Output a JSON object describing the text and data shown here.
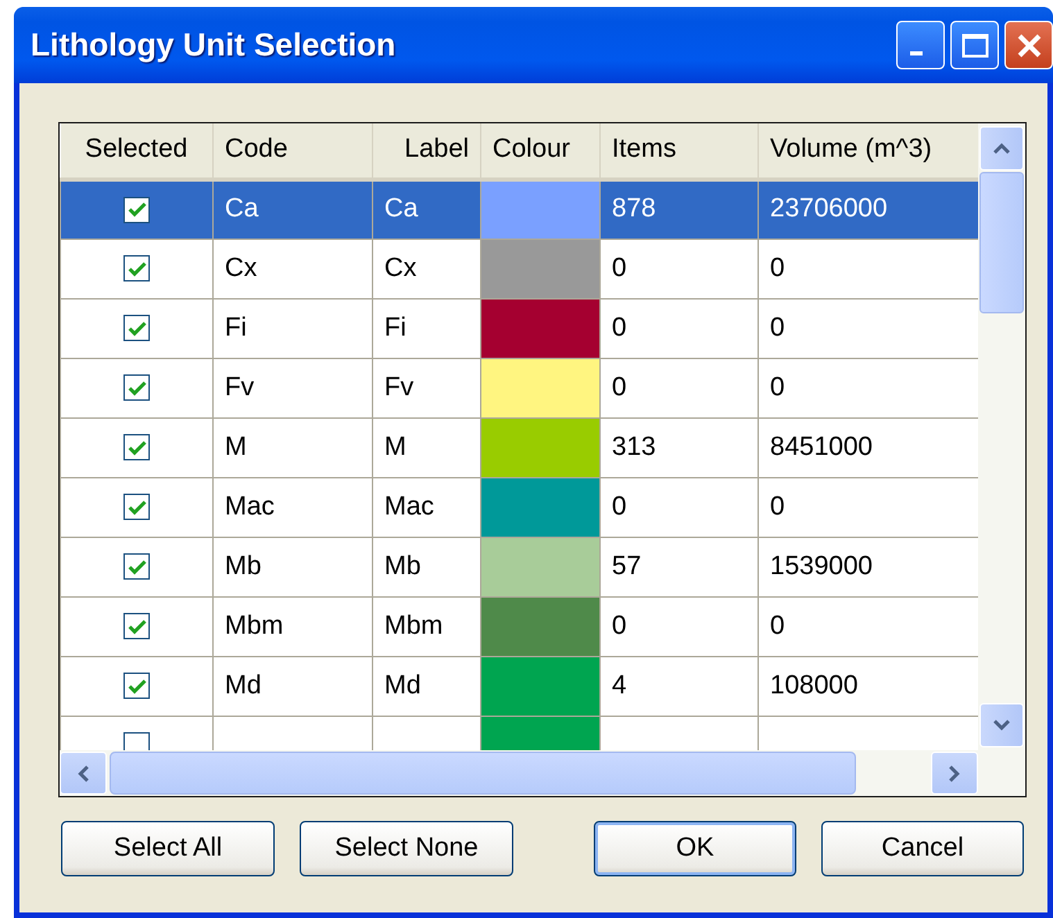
{
  "window": {
    "title": "Lithology Unit Selection"
  },
  "table": {
    "columns": [
      "Selected",
      "Code",
      "Label",
      "Colour",
      "Items",
      "Volume (m^3)"
    ],
    "rows": [
      {
        "selected": true,
        "checked": true,
        "code": "Ca",
        "label": "Ca",
        "color": "#7aa0ff",
        "items": "878",
        "volume": "23706000"
      },
      {
        "selected": false,
        "checked": true,
        "code": "Cx",
        "label": "Cx",
        "color": "#999999",
        "items": "0",
        "volume": "0"
      },
      {
        "selected": false,
        "checked": true,
        "code": "Fi",
        "label": "Fi",
        "color": "#a50030",
        "items": "0",
        "volume": "0"
      },
      {
        "selected": false,
        "checked": true,
        "code": "Fv",
        "label": "Fv",
        "color": "#fff580",
        "items": "0",
        "volume": "0"
      },
      {
        "selected": false,
        "checked": true,
        "code": "M",
        "label": "M",
        "color": "#99cc00",
        "items": "313",
        "volume": "8451000"
      },
      {
        "selected": false,
        "checked": true,
        "code": "Mac",
        "label": "Mac",
        "color": "#009999",
        "items": "0",
        "volume": "0"
      },
      {
        "selected": false,
        "checked": true,
        "code": "Mb",
        "label": "Mb",
        "color": "#a8cc99",
        "items": "57",
        "volume": "1539000"
      },
      {
        "selected": false,
        "checked": true,
        "code": "Mbm",
        "label": "Mbm",
        "color": "#4f8a4a",
        "items": "0",
        "volume": "0"
      },
      {
        "selected": false,
        "checked": true,
        "code": "Md",
        "label": "Md",
        "color": "#00a550",
        "items": "4",
        "volume": "108000"
      },
      {
        "selected": false,
        "checked": false,
        "color": "#00a550"
      }
    ]
  },
  "buttons": [
    "Select All",
    "Select None",
    "OK",
    "Cancel"
  ]
}
